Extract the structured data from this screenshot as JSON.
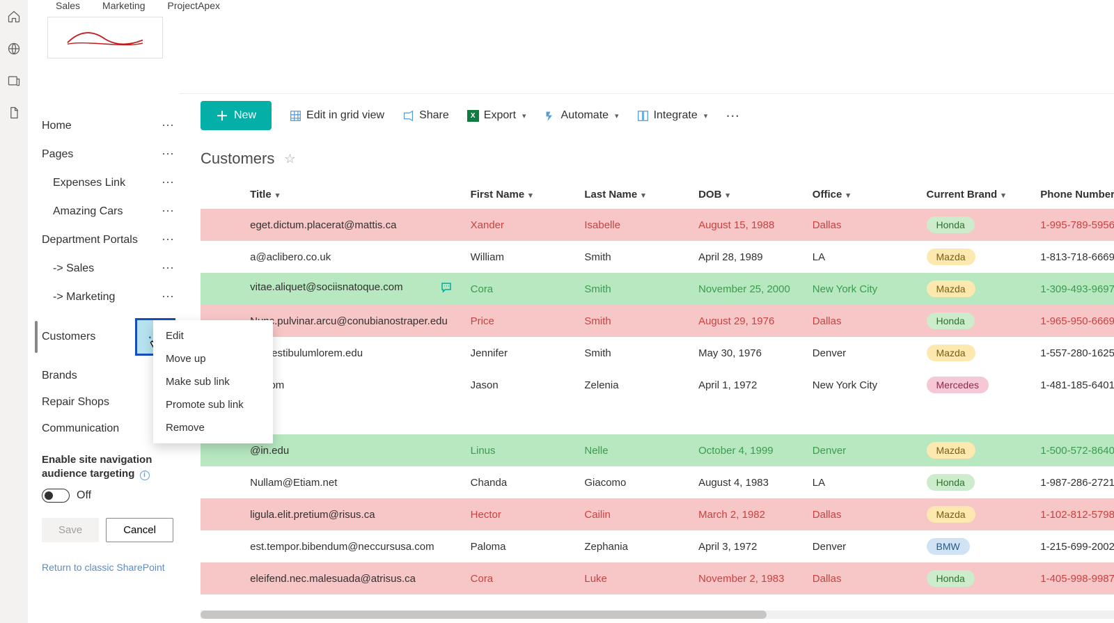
{
  "topTabs": {
    "t1": "Sales",
    "t2": "Marketing",
    "t3": "ProjectApex"
  },
  "nav": {
    "home": "Home",
    "pages": "Pages",
    "expenses": "Expenses Link",
    "amazing": "Amazing Cars",
    "dept": "Department Portals",
    "sales": "-> Sales",
    "marketing": "-> Marketing",
    "customers": "Customers",
    "brands": "Brands",
    "repair": "Repair Shops",
    "communication": "Communication"
  },
  "ctx": {
    "edit": "Edit",
    "moveUp": "Move up",
    "makeSub": "Make sub link",
    "promote": "Promote sub link",
    "remove": "Remove"
  },
  "targeting": {
    "title": "Enable site navigation audience targeting",
    "state": "Off",
    "save": "Save",
    "cancel": "Cancel"
  },
  "classicLink": "Return to classic SharePoint",
  "cmd": {
    "new": "New",
    "editGrid": "Edit in grid view",
    "share": "Share",
    "export": "Export",
    "automate": "Automate",
    "integrate": "Integrate"
  },
  "listTitle": "Customers",
  "columns": {
    "title": "Title",
    "first": "First Name",
    "last": "Last Name",
    "dob": "DOB",
    "office": "Office",
    "brand": "Current Brand",
    "phone": "Phone Number"
  },
  "rows": [
    {
      "cls": "row-red",
      "title": "eget.dictum.placerat@mattis.ca",
      "first": "Xander",
      "last": "Isabelle",
      "dob": "August 15, 1988",
      "office": "Dallas",
      "brand": "Honda",
      "phone": "1-995-789-5956",
      "colored": true,
      "comment": false
    },
    {
      "cls": "row-plain",
      "title": "a@aclibero.co.uk",
      "first": "William",
      "last": "Smith",
      "dob": "April 28, 1989",
      "office": "LA",
      "brand": "Mazda",
      "phone": "1-813-718-6669",
      "colored": false,
      "comment": false
    },
    {
      "cls": "row-green",
      "title": "vitae.aliquet@sociisnatoque.com",
      "first": "Cora",
      "last": "Smith",
      "dob": "November 25, 2000",
      "office": "New York City",
      "brand": "Mazda",
      "phone": "1-309-493-9697",
      "colored": true,
      "comment": true
    },
    {
      "cls": "row-red",
      "title": "Nunc.pulvinar.arcu@conubianostraper.edu",
      "first": "Price",
      "last": "Smith",
      "dob": "August 29, 1976",
      "office": "Dallas",
      "brand": "Honda",
      "phone": "1-965-950-6669",
      "colored": true,
      "comment": false
    },
    {
      "cls": "row-plain",
      "title": "e@vestibulumlorem.edu",
      "first": "Jennifer",
      "last": "Smith",
      "dob": "May 30, 1976",
      "office": "Denver",
      "brand": "Mazda",
      "phone": "1-557-280-1625",
      "colored": false,
      "comment": false
    },
    {
      "cls": "row-plain",
      "title": "on.com",
      "first": "Jason",
      "last": "Zelenia",
      "dob": "April 1, 1972",
      "office": "New York City",
      "brand": "Mercedes",
      "phone": "1-481-185-6401",
      "colored": false,
      "comment": false
    },
    {
      "cls": "row-gap",
      "title": "",
      "first": "",
      "last": "",
      "dob": "",
      "office": "",
      "brand": "",
      "phone": "",
      "colored": false,
      "comment": false
    },
    {
      "cls": "row-green",
      "title": "@in.edu",
      "first": "Linus",
      "last": "Nelle",
      "dob": "October 4, 1999",
      "office": "Denver",
      "brand": "Mazda",
      "phone": "1-500-572-8640",
      "colored": true,
      "comment": false
    },
    {
      "cls": "row-plain",
      "title": "Nullam@Etiam.net",
      "first": "Chanda",
      "last": "Giacomo",
      "dob": "August 4, 1983",
      "office": "LA",
      "brand": "Honda",
      "phone": "1-987-286-2721",
      "colored": false,
      "comment": false
    },
    {
      "cls": "row-red",
      "title": "ligula.elit.pretium@risus.ca",
      "first": "Hector",
      "last": "Cailin",
      "dob": "March 2, 1982",
      "office": "Dallas",
      "brand": "Mazda",
      "phone": "1-102-812-5798",
      "colored": true,
      "comment": false
    },
    {
      "cls": "row-plain",
      "title": "est.tempor.bibendum@neccursusa.com",
      "first": "Paloma",
      "last": "Zephania",
      "dob": "April 3, 1972",
      "office": "Denver",
      "brand": "BMW",
      "phone": "1-215-699-2002",
      "colored": false,
      "comment": false
    },
    {
      "cls": "row-red",
      "title": "eleifend.nec.malesuada@atrisus.ca",
      "first": "Cora",
      "last": "Luke",
      "dob": "November 2, 1983",
      "office": "Dallas",
      "brand": "Honda",
      "phone": "1-405-998-9987",
      "colored": true,
      "comment": false
    }
  ]
}
